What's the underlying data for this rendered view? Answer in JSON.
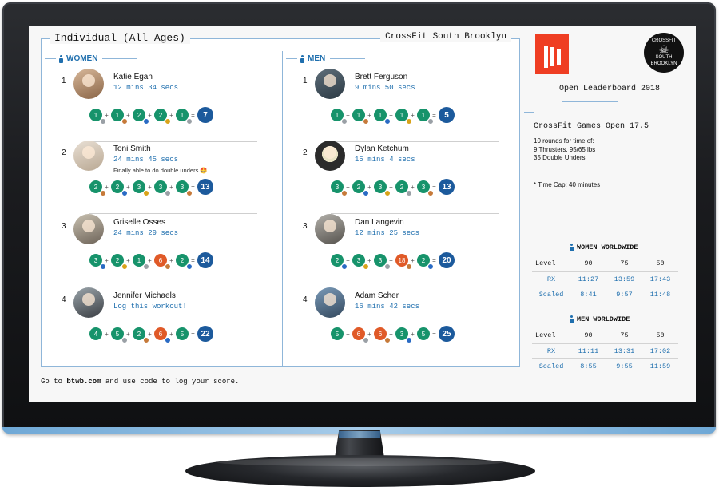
{
  "board": {
    "title": "Individual (All Ages)",
    "gym": "CrossFit South Brooklyn",
    "women_label": "WOMEN",
    "men_label": "MEN"
  },
  "women": [
    {
      "rank": "1",
      "name": "Katie Egan",
      "score": "12 mins 34 secs",
      "comment": "",
      "badges": [
        "1",
        "1",
        "2",
        "2",
        "1"
      ],
      "total": "7"
    },
    {
      "rank": "2",
      "name": "Toni Smith",
      "score": "24 mins 45 secs",
      "comment": "Finally able to do double unders 🤩",
      "badges": [
        "2",
        "2",
        "3",
        "3",
        "3"
      ],
      "total": "13"
    },
    {
      "rank": "3",
      "name": "Griselle Osses",
      "score": "24 mins 29 secs",
      "comment": "",
      "badges": [
        "3",
        "2",
        "1",
        "6",
        "2"
      ],
      "total": "14"
    },
    {
      "rank": "4",
      "name": "Jennifer Michaels",
      "score": "Log this workout!",
      "comment": "",
      "badges": [
        "4",
        "5",
        "2",
        "6",
        "5"
      ],
      "total": "22"
    }
  ],
  "men": [
    {
      "rank": "1",
      "name": "Brett Ferguson",
      "score": "9 mins 50 secs",
      "comment": "",
      "badges": [
        "1",
        "1",
        "1",
        "1",
        "1"
      ],
      "total": "5"
    },
    {
      "rank": "2",
      "name": "Dylan Ketchum",
      "score": "15 mins 4 secs",
      "comment": "",
      "badges": [
        "3",
        "2",
        "3",
        "2",
        "3"
      ],
      "total": "13"
    },
    {
      "rank": "3",
      "name": "Dan Langevin",
      "score": "12 mins 25 secs",
      "comment": "",
      "badges": [
        "2",
        "3",
        "3",
        "18",
        "2"
      ],
      "total": "20"
    },
    {
      "rank": "4",
      "name": "Adam Scher",
      "score": "16 mins 42 secs",
      "comment": "",
      "badges": [
        "5",
        "6",
        "6",
        "3",
        "5"
      ],
      "total": "25"
    }
  ],
  "footer": {
    "pre": "Go to ",
    "site": "btwb.com",
    "post": " and use code     to log your score."
  },
  "side": {
    "cf_top": "CROSSFIT",
    "cf_bottom": "SOUTH BROOKLYN",
    "leaderboard_title": "Open Leaderboard 2018",
    "workout_title": "CrossFit Games Open 17.5",
    "desc": [
      "10 rounds for time of:",
      "9 Thrusters, 95/65 lbs",
      "35 Double Unders"
    ],
    "timecap": "* Time Cap: 40 minutes",
    "women_ww": {
      "title": "WOMEN WORLDWIDE",
      "header": [
        "Level",
        "90",
        "75",
        "50"
      ],
      "rx": [
        "RX",
        "11:27",
        "13:59",
        "17:43"
      ],
      "scaled": [
        "Scaled",
        "8:41",
        "9:57",
        "11:48"
      ]
    },
    "men_ww": {
      "title": "MEN WORLDWIDE",
      "header": [
        "Level",
        "90",
        "75",
        "50"
      ],
      "rx": [
        "RX",
        "11:11",
        "13:31",
        "17:02"
      ],
      "scaled": [
        "Scaled",
        "8:55",
        "9:55",
        "11:59"
      ]
    }
  },
  "colors": {
    "accent": "#1f6fae",
    "badge_green": "#17936b",
    "badge_orange": "#e05a28",
    "total_blue": "#1c5a9c",
    "logo_red": "#ef3e23"
  },
  "icons": {
    "person": "person-icon",
    "skull": "skull-icon",
    "medal": "medal-icon"
  }
}
